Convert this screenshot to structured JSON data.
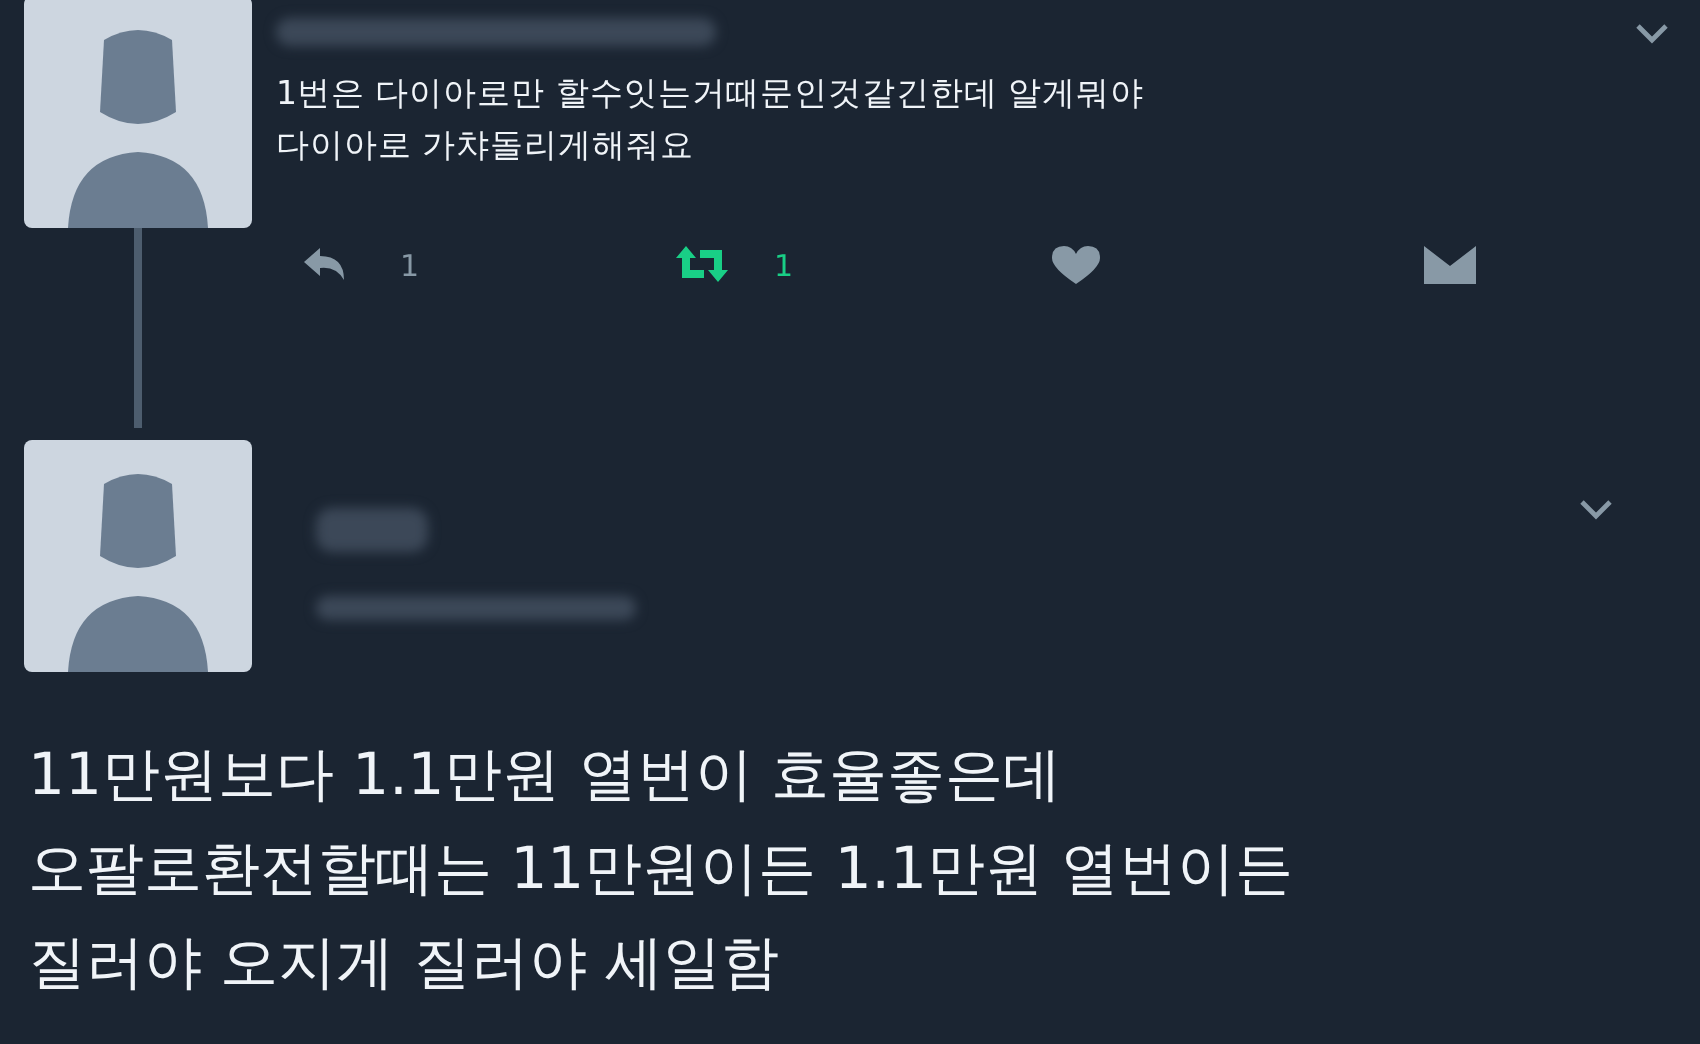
{
  "reply_tweet": {
    "text_lines": [
      "1번은 다이아로만 할수잇는거때문인것같긴한데 알게뭐야",
      "다이아로 가챠돌리게해줘요"
    ],
    "actions": [
      {
        "kind": "reply",
        "count": "1",
        "active": false
      },
      {
        "kind": "retweet",
        "count": "1",
        "active": true
      },
      {
        "kind": "like",
        "active": false
      },
      {
        "kind": "message",
        "active": false
      }
    ]
  },
  "main_tweet": {
    "text_lines": [
      "11만원보다 1.1만원 열번이 효율좋은데",
      "오팔로환전할때는 11만원이든 1.1만원 열번이든",
      "질러야 오지게 질러야 세일함"
    ]
  }
}
